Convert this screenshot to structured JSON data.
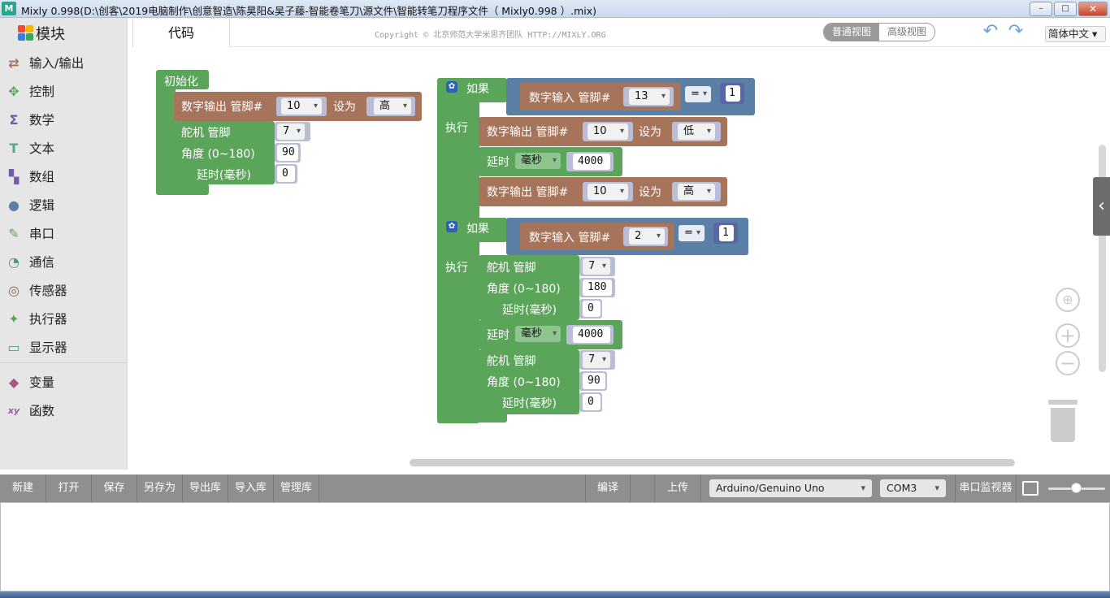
{
  "window": {
    "title": "Mixly 0.998(D:\\创客\\2019电脑制作\\创意智造\\陈昊阳&吴子藤-智能卷笔刀\\源文件\\智能转笔刀程序文件（ Mixly0.998 ）.mix)",
    "min": "–",
    "max": "□",
    "close": "✕"
  },
  "sidebar": {
    "title": "模块",
    "items": [
      {
        "label": "输入/输出",
        "icon": "io-arrows-icon",
        "color": "#a5745b"
      },
      {
        "label": "控制",
        "icon": "gamepad-icon",
        "color": "#5ba55b"
      },
      {
        "label": "数学",
        "icon": "sigma-icon",
        "color": "#5b67a5"
      },
      {
        "label": "文本",
        "icon": "text-t-icon",
        "color": "#5ba58c"
      },
      {
        "label": "数组",
        "icon": "blocks-icon",
        "color": "#745ba5"
      },
      {
        "label": "逻辑",
        "icon": "bulb-icon",
        "color": "#5b80a5"
      },
      {
        "label": "串口",
        "icon": "pen-icon",
        "color": "#5ba55b"
      },
      {
        "label": "通信",
        "icon": "satellite-icon",
        "color": "#4d9c7c"
      },
      {
        "label": "传感器",
        "icon": "sensor-icon",
        "color": "#8a6a4a"
      },
      {
        "label": "执行器",
        "icon": "actuator-icon",
        "color": "#5ba55b"
      },
      {
        "label": "显示器",
        "icon": "monitor-icon",
        "color": "#4a9a9a"
      },
      {
        "label": "变量",
        "icon": "cube-icon",
        "color": "#a55b80"
      },
      {
        "label": "函数",
        "icon": "xy-icon",
        "color": "#995ba5"
      }
    ]
  },
  "tabs": {
    "code": "代码",
    "copyright": "Copyright © 北京师范大学米思齐团队 HTTP://MIXLY.ORG",
    "normal_view": "普通视图",
    "advanced_view": "高级视图",
    "language": "简体中文"
  },
  "blocks": {
    "setup": {
      "title": "初始化",
      "dout_label": "数字输出 管脚#",
      "dout_pin": "10",
      "set_label": "设为",
      "dout_val": "高",
      "servo_label": "舵机 管脚",
      "servo_pin": "7",
      "angle_label": "角度 (0~180)",
      "angle_val": "90",
      "delay_label": "延时(毫秒)",
      "delay_val": "0"
    },
    "if1": {
      "if_label": "如果",
      "din_label": "数字输入 管脚#",
      "din_pin": "13",
      "op": "=",
      "cmp": "1",
      "do_label": "执行",
      "dout1_label": "数字输出 管脚#",
      "dout1_pin": "10",
      "set1": "设为",
      "dout1_val": "低",
      "delay_label": "延时",
      "delay_unit": "毫秒",
      "delay_val": "4000",
      "dout2_label": "数字输出 管脚#",
      "dout2_pin": "10",
      "set2": "设为",
      "dout2_val": "高"
    },
    "if2": {
      "if_label": "如果",
      "din_label": "数字输入 管脚#",
      "din_pin": "2",
      "op": "=",
      "cmp": "1",
      "do_label": "执行",
      "servo1_label": "舵机 管脚",
      "servo1_pin": "7",
      "angle1_label": "角度 (0~180)",
      "angle1_val": "180",
      "sdelay1_label": "延时(毫秒)",
      "sdelay1_val": "0",
      "delay_label": "延时",
      "delay_unit": "毫秒",
      "delay_val": "4000",
      "servo2_label": "舵机 管脚",
      "servo2_pin": "7",
      "angle2_label": "角度 (0~180)",
      "angle2_val": "90",
      "sdelay2_label": "延时(毫秒)",
      "sdelay2_val": "0"
    }
  },
  "toolbar": {
    "new": "新建",
    "open": "打开",
    "save": "保存",
    "saveas": "另存为",
    "export": "导出库",
    "import": "导入库",
    "manage": "管理库",
    "compile": "编译",
    "upload": "上传",
    "board": "Arduino/Genuino Uno",
    "port": "COM3",
    "monitor": "串口监视器"
  }
}
